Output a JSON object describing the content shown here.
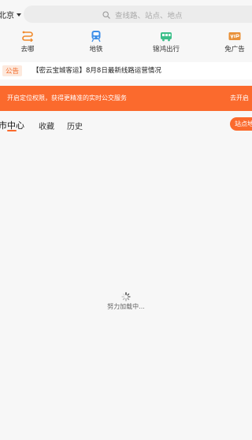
{
  "header": {
    "city": "北京",
    "search": {
      "placeholder": "查线路、站点、地点"
    }
  },
  "quick_nav": [
    {
      "label": "去哪",
      "icon": "route-icon"
    },
    {
      "label": "地铁",
      "icon": "subway-icon"
    },
    {
      "label": "锦鸿出行",
      "icon": "bus-icon"
    },
    {
      "label": "免广告",
      "icon": "vip-icon"
    }
  ],
  "notice": {
    "tag": "公告",
    "text": "【密云宝城客运】8月8日最新线路运营情况"
  },
  "location_prompt": {
    "text": "开启定位权限，获得更精准的实时公交服务",
    "action": "去开启"
  },
  "tabs": [
    {
      "label": "市中心",
      "active": true
    },
    {
      "label": "收藏",
      "active": false
    },
    {
      "label": "历史",
      "active": false
    }
  ],
  "nearby_button": "站点地",
  "loading": {
    "text": "努力加载中..."
  },
  "colors": {
    "accent": "#fb6a2d",
    "background": "#f7f7f7"
  }
}
